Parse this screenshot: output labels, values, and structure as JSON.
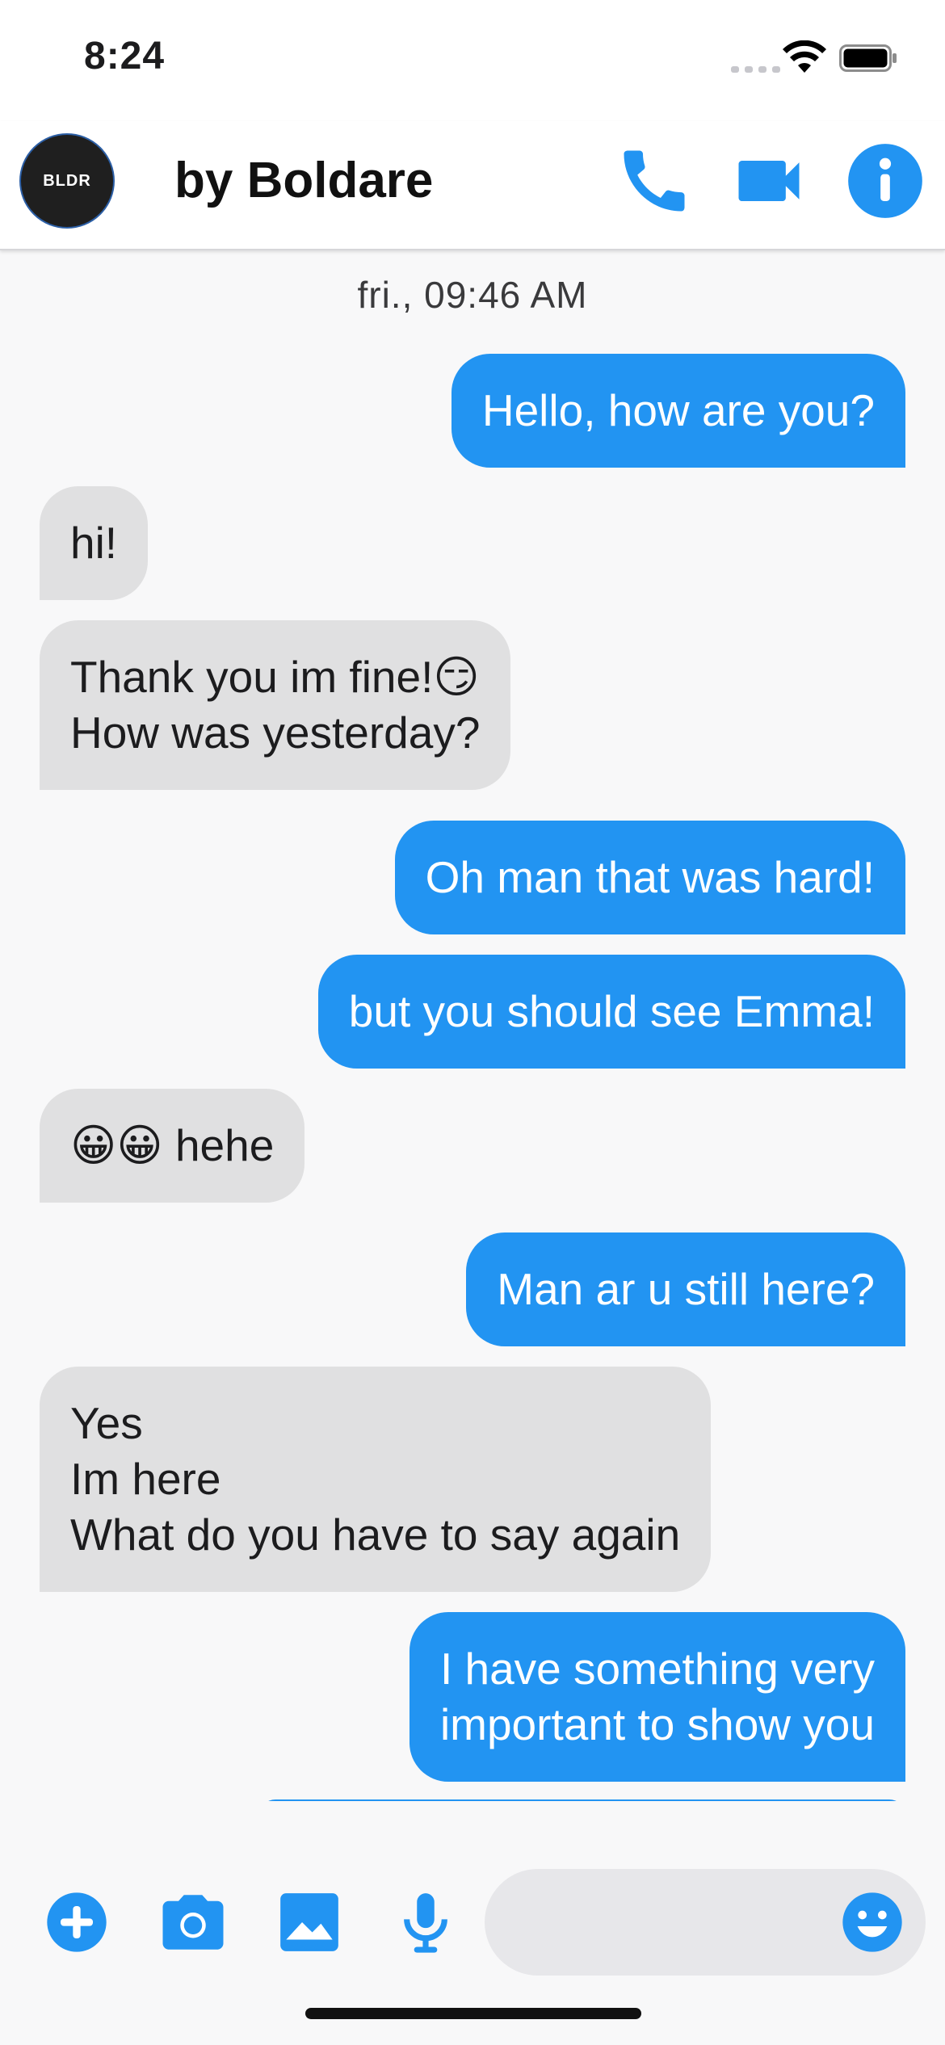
{
  "status_bar": {
    "time": "8:24"
  },
  "header": {
    "avatar_text": "BLDR",
    "title": "by Boldare",
    "buttons": {
      "call": "phone-icon",
      "video": "video-camera-icon",
      "info": "info-icon"
    },
    "accent": "#2294f2"
  },
  "chat": {
    "timestamp": "fri., 09:46 AM",
    "colors": {
      "outgoing": "#2294f2",
      "incoming": "#e0e0e1"
    },
    "messages": [
      {
        "from": "me",
        "text": "Hello, how are you?"
      },
      {
        "from": "them",
        "text": "hi!"
      },
      {
        "from": "them",
        "text": "Thank you im fine!😏\nHow was yesterday?"
      },
      {
        "from": "me",
        "text": "Oh man that was hard!"
      },
      {
        "from": "me",
        "text": "but you should see Emma!"
      },
      {
        "from": "them",
        "text": "😀😀 hehe"
      },
      {
        "from": "me",
        "text": "Man ar u still here?"
      },
      {
        "from": "them",
        "text": "Yes\nIm here\nWhat do you have to say again"
      },
      {
        "from": "me",
        "text": "I have something very\nimportant to show you"
      }
    ]
  },
  "composer": {
    "buttons": [
      "add-icon",
      "camera-icon",
      "image-icon",
      "microphone-icon"
    ],
    "input_value": "",
    "emoji_button": "smiley-icon"
  }
}
